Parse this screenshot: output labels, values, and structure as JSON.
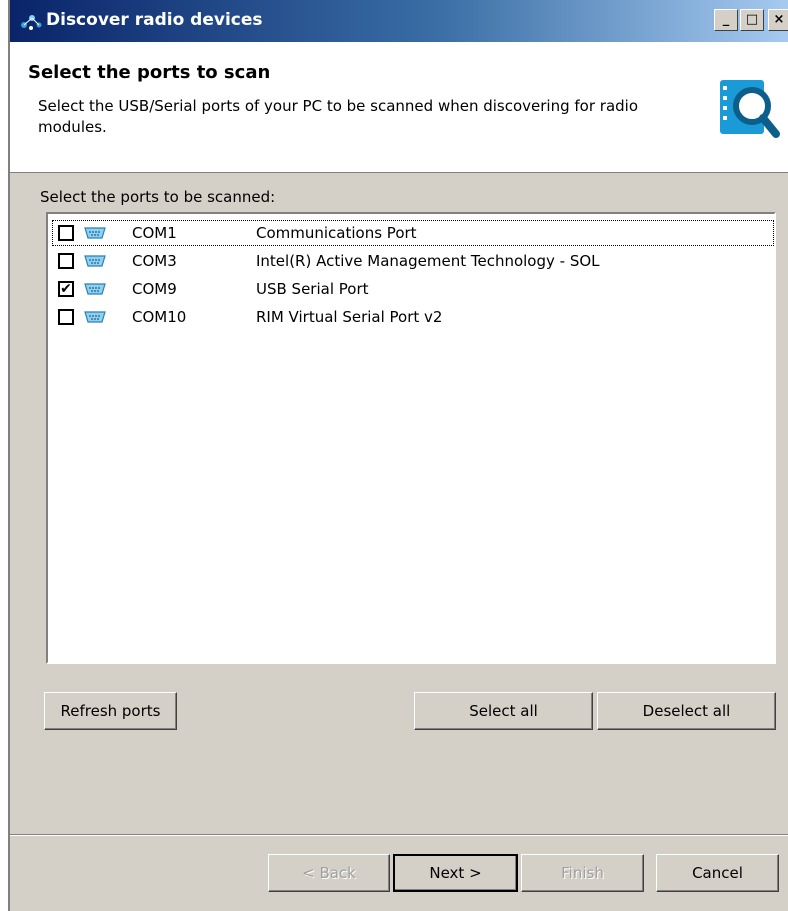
{
  "window": {
    "title": "Discover radio devices"
  },
  "caption_buttons": {
    "minimize": "_",
    "maximize": "□",
    "close": "×"
  },
  "header": {
    "title": "Select the ports to scan",
    "description": "Select the USB/Serial ports of your PC to be scanned when discovering for radio modules."
  },
  "ports": {
    "label": "Select the ports to be scanned:",
    "items": [
      {
        "name": "COM1",
        "description": "Communications Port",
        "checked": false,
        "focused": true
      },
      {
        "name": "COM3",
        "description": "Intel(R) Active Management Technology - SOL",
        "checked": false,
        "focused": false
      },
      {
        "name": "COM9",
        "description": "USB Serial Port",
        "checked": true,
        "focused": false
      },
      {
        "name": "COM10",
        "description": "RIM Virtual Serial Port v2",
        "checked": false,
        "focused": false
      }
    ]
  },
  "actions": {
    "refresh": "Refresh ports",
    "select_all": "Select all",
    "deselect_all": "Deselect all"
  },
  "footer": {
    "back": "< Back",
    "next": "Next >",
    "finish": "Finish",
    "cancel": "Cancel"
  },
  "colors": {
    "titlebar_start": "#0a246a",
    "titlebar_end": "#a6caf0",
    "accent": "#1a9bd7",
    "dialog_bg": "#d4d0c8"
  }
}
